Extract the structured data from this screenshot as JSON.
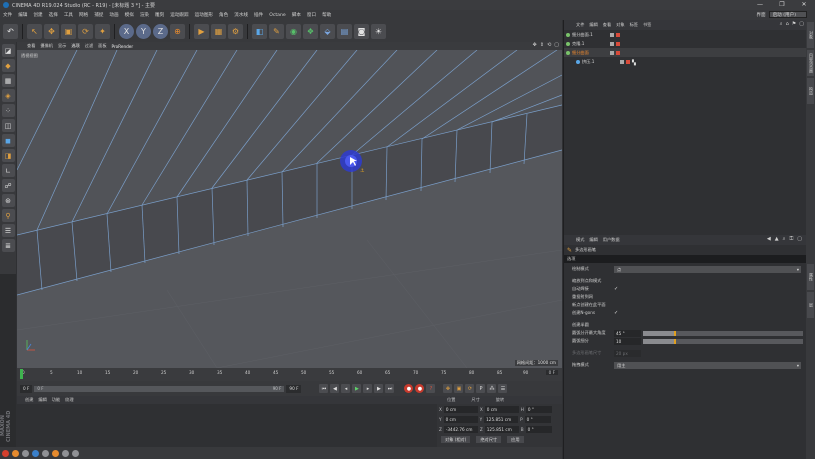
{
  "window": {
    "title": "CINEMA 4D R19.024 Studio (RC - R19) - [未标题 3 *] - 主要",
    "controls": [
      "—",
      "❐",
      "✕"
    ]
  },
  "menubar": {
    "items": [
      "文件",
      "编辑",
      "创建",
      "选择",
      "工具",
      "网格",
      "捕捉",
      "动画",
      "模拟",
      "渲染",
      "雕刻",
      "运动跟踪",
      "运动图形",
      "角色",
      "流水线",
      "插件",
      "Octane",
      "脚本",
      "窗口",
      "帮助"
    ],
    "layout_label": "界面",
    "layout_value": "启动 (用户)"
  },
  "toolbar": {
    "icons": [
      "undo-icon",
      "pointer-icon",
      "move-icon",
      "scale-icon",
      "rotate-icon",
      "recent-icon",
      "x-axis-icon",
      "y-axis-icon",
      "z-axis-icon",
      "coord-system-icon",
      "render-view-icon",
      "render-picture-icon",
      "render-settings-icon",
      "cube-icon",
      "pen-icon",
      "subdivision-icon",
      "array-icon",
      "deformer-icon",
      "floor-icon",
      "camera-icon",
      "light-icon"
    ],
    "axis_x": "X",
    "axis_y": "Y",
    "axis_z": "Z"
  },
  "viewport": {
    "menu": [
      "查看",
      "摄像机",
      "显示",
      "选项",
      "过滤",
      "面板",
      "ProRender"
    ],
    "active_menu": "选项",
    "label": "透视视图",
    "grid_info": "网格间距：1000 cm"
  },
  "timeline": {
    "ticks": [
      "0",
      "5",
      "10",
      "15",
      "20",
      "25",
      "30",
      "35",
      "40",
      "45",
      "50",
      "55",
      "60",
      "65",
      "70",
      "75",
      "80",
      "85",
      "90"
    ],
    "end_label": "0 F"
  },
  "transport": {
    "start": "0 F",
    "current": "0 F",
    "end": "90 F",
    "end2": "90 F"
  },
  "material": {
    "menu": [
      "创建",
      "编辑",
      "功能",
      "纹理"
    ]
  },
  "coords": {
    "headers": [
      "位置",
      "尺寸",
      "旋转"
    ],
    "rows": [
      {
        "axis": "X",
        "pos": "0 cm",
        "saxis": "X",
        "size": "0 cm",
        "raxis": "H",
        "rot": "0 °"
      },
      {
        "axis": "Y",
        "pos": "0 cm",
        "saxis": "Y",
        "size": "125.851 cm",
        "raxis": "P",
        "rot": "0 °"
      },
      {
        "axis": "Z",
        "pos": "-3442.76 cm",
        "saxis": "Z",
        "size": "125.851 cm",
        "raxis": "B",
        "rot": "0 °"
      }
    ],
    "mode": "对象 (相对)",
    "size_mode": "绝对尺寸",
    "apply": "应用"
  },
  "objects": {
    "menu": [
      "文件",
      "编辑",
      "查看",
      "对象",
      "标签",
      "书签"
    ],
    "items": [
      {
        "name": "细分曲面.1",
        "color": "normal",
        "selected": false
      },
      {
        "name": "克隆.1",
        "color": "normal",
        "selected": false
      },
      {
        "name": "细分曲面",
        "color": "orange",
        "selected": true
      },
      {
        "name": "挤压.1",
        "color": "normal",
        "selected": false
      }
    ]
  },
  "attributes": {
    "menu": [
      "模式",
      "编辑",
      "用户数据"
    ],
    "title": "多边形画笔",
    "tab": "选项",
    "draw_mode_label": "绘制模式",
    "draw_mode_value": "点",
    "rows": [
      {
        "label": "缩放到点和模式",
        "type": "check",
        "value": ""
      },
      {
        "label": "自动焊接",
        "type": "check",
        "value": "✓"
      },
      {
        "label": "重投射到网",
        "type": "check",
        "value": ""
      },
      {
        "label": "新点创建在此平面",
        "type": "check",
        "value": ""
      },
      {
        "label": "创建N-gons",
        "type": "check",
        "value": "✓"
      }
    ],
    "quads_label": "创建半圆",
    "angle_label": "圆弧分开最大角度",
    "angle_value": "45 °",
    "angle_fraction": 0.2,
    "subdiv_label": "圆弧细分",
    "subdiv_value": "10",
    "subdiv_fraction": 0.2,
    "snap_label": "多边形画笔尺寸",
    "snap_value": "20 px",
    "mode_label": "拖拽模式",
    "mode_value": "用主"
  },
  "right_tabs": [
    "对象",
    "内容浏览器",
    "构造",
    "属性",
    "层"
  ],
  "brand": "MAXON CINEMA 4D"
}
